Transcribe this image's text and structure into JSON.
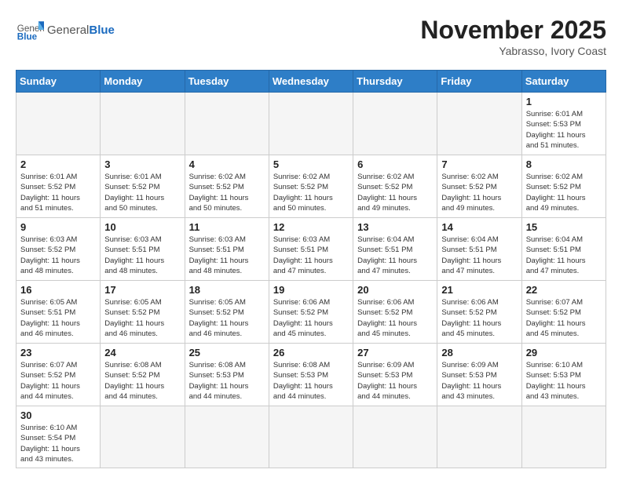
{
  "header": {
    "logo_general": "General",
    "logo_blue": "Blue",
    "month_title": "November 2025",
    "subtitle": "Yabrasso, Ivory Coast"
  },
  "days_of_week": [
    "Sunday",
    "Monday",
    "Tuesday",
    "Wednesday",
    "Thursday",
    "Friday",
    "Saturday"
  ],
  "weeks": [
    [
      {
        "day": "",
        "info": ""
      },
      {
        "day": "",
        "info": ""
      },
      {
        "day": "",
        "info": ""
      },
      {
        "day": "",
        "info": ""
      },
      {
        "day": "",
        "info": ""
      },
      {
        "day": "",
        "info": ""
      },
      {
        "day": "1",
        "info": "Sunrise: 6:01 AM\nSunset: 5:53 PM\nDaylight: 11 hours\nand 51 minutes."
      }
    ],
    [
      {
        "day": "2",
        "info": "Sunrise: 6:01 AM\nSunset: 5:52 PM\nDaylight: 11 hours\nand 51 minutes."
      },
      {
        "day": "3",
        "info": "Sunrise: 6:01 AM\nSunset: 5:52 PM\nDaylight: 11 hours\nand 50 minutes."
      },
      {
        "day": "4",
        "info": "Sunrise: 6:02 AM\nSunset: 5:52 PM\nDaylight: 11 hours\nand 50 minutes."
      },
      {
        "day": "5",
        "info": "Sunrise: 6:02 AM\nSunset: 5:52 PM\nDaylight: 11 hours\nand 50 minutes."
      },
      {
        "day": "6",
        "info": "Sunrise: 6:02 AM\nSunset: 5:52 PM\nDaylight: 11 hours\nand 49 minutes."
      },
      {
        "day": "7",
        "info": "Sunrise: 6:02 AM\nSunset: 5:52 PM\nDaylight: 11 hours\nand 49 minutes."
      },
      {
        "day": "8",
        "info": "Sunrise: 6:02 AM\nSunset: 5:52 PM\nDaylight: 11 hours\nand 49 minutes."
      }
    ],
    [
      {
        "day": "9",
        "info": "Sunrise: 6:03 AM\nSunset: 5:52 PM\nDaylight: 11 hours\nand 48 minutes."
      },
      {
        "day": "10",
        "info": "Sunrise: 6:03 AM\nSunset: 5:51 PM\nDaylight: 11 hours\nand 48 minutes."
      },
      {
        "day": "11",
        "info": "Sunrise: 6:03 AM\nSunset: 5:51 PM\nDaylight: 11 hours\nand 48 minutes."
      },
      {
        "day": "12",
        "info": "Sunrise: 6:03 AM\nSunset: 5:51 PM\nDaylight: 11 hours\nand 47 minutes."
      },
      {
        "day": "13",
        "info": "Sunrise: 6:04 AM\nSunset: 5:51 PM\nDaylight: 11 hours\nand 47 minutes."
      },
      {
        "day": "14",
        "info": "Sunrise: 6:04 AM\nSunset: 5:51 PM\nDaylight: 11 hours\nand 47 minutes."
      },
      {
        "day": "15",
        "info": "Sunrise: 6:04 AM\nSunset: 5:51 PM\nDaylight: 11 hours\nand 47 minutes."
      }
    ],
    [
      {
        "day": "16",
        "info": "Sunrise: 6:05 AM\nSunset: 5:51 PM\nDaylight: 11 hours\nand 46 minutes."
      },
      {
        "day": "17",
        "info": "Sunrise: 6:05 AM\nSunset: 5:52 PM\nDaylight: 11 hours\nand 46 minutes."
      },
      {
        "day": "18",
        "info": "Sunrise: 6:05 AM\nSunset: 5:52 PM\nDaylight: 11 hours\nand 46 minutes."
      },
      {
        "day": "19",
        "info": "Sunrise: 6:06 AM\nSunset: 5:52 PM\nDaylight: 11 hours\nand 45 minutes."
      },
      {
        "day": "20",
        "info": "Sunrise: 6:06 AM\nSunset: 5:52 PM\nDaylight: 11 hours\nand 45 minutes."
      },
      {
        "day": "21",
        "info": "Sunrise: 6:06 AM\nSunset: 5:52 PM\nDaylight: 11 hours\nand 45 minutes."
      },
      {
        "day": "22",
        "info": "Sunrise: 6:07 AM\nSunset: 5:52 PM\nDaylight: 11 hours\nand 45 minutes."
      }
    ],
    [
      {
        "day": "23",
        "info": "Sunrise: 6:07 AM\nSunset: 5:52 PM\nDaylight: 11 hours\nand 44 minutes."
      },
      {
        "day": "24",
        "info": "Sunrise: 6:08 AM\nSunset: 5:52 PM\nDaylight: 11 hours\nand 44 minutes."
      },
      {
        "day": "25",
        "info": "Sunrise: 6:08 AM\nSunset: 5:53 PM\nDaylight: 11 hours\nand 44 minutes."
      },
      {
        "day": "26",
        "info": "Sunrise: 6:08 AM\nSunset: 5:53 PM\nDaylight: 11 hours\nand 44 minutes."
      },
      {
        "day": "27",
        "info": "Sunrise: 6:09 AM\nSunset: 5:53 PM\nDaylight: 11 hours\nand 44 minutes."
      },
      {
        "day": "28",
        "info": "Sunrise: 6:09 AM\nSunset: 5:53 PM\nDaylight: 11 hours\nand 43 minutes."
      },
      {
        "day": "29",
        "info": "Sunrise: 6:10 AM\nSunset: 5:53 PM\nDaylight: 11 hours\nand 43 minutes."
      }
    ],
    [
      {
        "day": "30",
        "info": "Sunrise: 6:10 AM\nSunset: 5:54 PM\nDaylight: 11 hours\nand 43 minutes."
      },
      {
        "day": "",
        "info": ""
      },
      {
        "day": "",
        "info": ""
      },
      {
        "day": "",
        "info": ""
      },
      {
        "day": "",
        "info": ""
      },
      {
        "day": "",
        "info": ""
      },
      {
        "day": "",
        "info": ""
      }
    ]
  ]
}
